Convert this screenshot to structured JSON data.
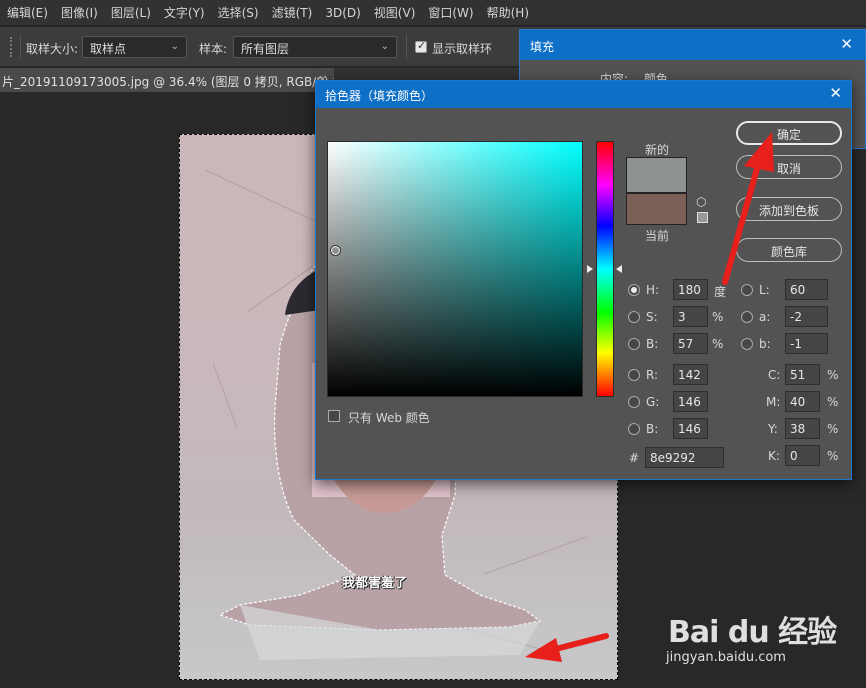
{
  "menu": [
    "编辑(E)",
    "图像(I)",
    "图层(L)",
    "文字(Y)",
    "选择(S)",
    "滤镜(T)",
    "3D(D)",
    "视图(V)",
    "窗口(W)",
    "帮助(H)"
  ],
  "options": {
    "sample_size_label": "取样大小:",
    "sample_size_value": "取样点",
    "sample_label": "样本:",
    "sample_value": "所有图层",
    "show_ring_label": "显示取样环",
    "show_ring_checked": true
  },
  "document": {
    "tab_title": "片_20191109173005.jpg @ 36.4% (图层 0 拷贝, RGB/8) *",
    "close": "×"
  },
  "canvas": {
    "caption": "我都害羞了"
  },
  "fill_dialog": {
    "title": "填充",
    "content_label": "内容:",
    "content_value": "颜色"
  },
  "picker": {
    "title": "拾色器（填充颜色）",
    "new_label": "新的",
    "current_label": "当前",
    "new_color": "#8e9292",
    "current_color": "#7a5f56",
    "buttons": {
      "ok": "确定",
      "cancel": "取消",
      "add_swatch": "添加到色板",
      "libraries": "颜色库"
    },
    "web_only_label": "只有 Web 颜色",
    "hsb": {
      "h_label": "H:",
      "h_value": "180",
      "h_unit": "度",
      "s_label": "S:",
      "s_value": "3",
      "s_unit": "%",
      "b_label": "B:",
      "b_value": "57",
      "b_unit": "%"
    },
    "lab": {
      "l_label": "L:",
      "l_value": "60",
      "a_label": "a:",
      "a_value": "-2",
      "b_label": "b:",
      "b_value": "-1"
    },
    "rgb": {
      "r_label": "R:",
      "r_value": "142",
      "g_label": "G:",
      "g_value": "146",
      "b_label": "B:",
      "b_value": "146"
    },
    "cmyk": {
      "c_label": "C:",
      "c_value": "51",
      "m_label": "M:",
      "m_value": "40",
      "y_label": "Y:",
      "y_value": "38",
      "k_label": "K:",
      "k_value": "0",
      "unit": "%"
    },
    "hex_label": "#",
    "hex_value": "8e9292"
  },
  "watermark": {
    "brand": "Bai du 经验",
    "url": "jingyan.baidu.com"
  },
  "colors": {
    "accent": "#0e6fc7",
    "arrow": "#e8201c"
  }
}
